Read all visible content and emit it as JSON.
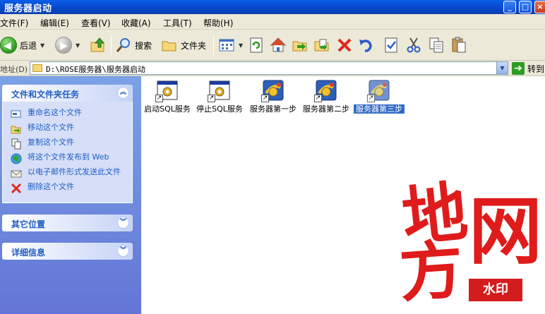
{
  "window": {
    "title": "服务器启动"
  },
  "menu": [
    {
      "label": "文件(F)"
    },
    {
      "label": "编辑(E)"
    },
    {
      "label": "查看(V)"
    },
    {
      "label": "收藏(A)"
    },
    {
      "label": "工具(T)"
    },
    {
      "label": "帮助(H)"
    }
  ],
  "toolbar": {
    "back_label": "后退",
    "search_label": "搜索",
    "folders_label": "文件夹"
  },
  "address": {
    "label": "地址(D)",
    "path": "D:\\ROSE服务器\\服务器启动",
    "go_label": "转到"
  },
  "taskpane": {
    "file_tasks": {
      "title": "文件和文件夹任务",
      "items": [
        {
          "label": "重命名这个文件",
          "icon": "rename-icon"
        },
        {
          "label": "移动这个文件",
          "icon": "move-icon"
        },
        {
          "label": "复制这个文件",
          "icon": "copy-icon"
        },
        {
          "label": "将这个文件发布到 Web",
          "icon": "publish-web-icon"
        },
        {
          "label": "以电子邮件形式发送此文件",
          "icon": "email-icon"
        },
        {
          "label": "删除这个文件",
          "icon": "delete-icon"
        }
      ]
    },
    "other_places": {
      "title": "其它位置"
    },
    "details": {
      "title": "详细信息"
    }
  },
  "files": [
    {
      "name": "启动SQL服务",
      "icon": "sql-service-shortcut-icon"
    },
    {
      "name": "停止SQL服务",
      "icon": "sql-service-shortcut-icon"
    },
    {
      "name": "服务器第一步",
      "icon": "server-app-shortcut-icon"
    },
    {
      "name": "服务器第二步",
      "icon": "server-app-shortcut-icon"
    },
    {
      "name": "服务器第三步",
      "icon": "server-app-shortcut-icon",
      "selected": true
    }
  ],
  "watermark": {
    "chars": [
      "地",
      "网",
      "方"
    ],
    "stamp": "水印"
  },
  "colors": {
    "titlebar": "#0a5ee8",
    "taskpane": "#7ba2e7",
    "link": "#215dc6",
    "selection": "#316ac5",
    "watermark": "#e01b1b"
  }
}
